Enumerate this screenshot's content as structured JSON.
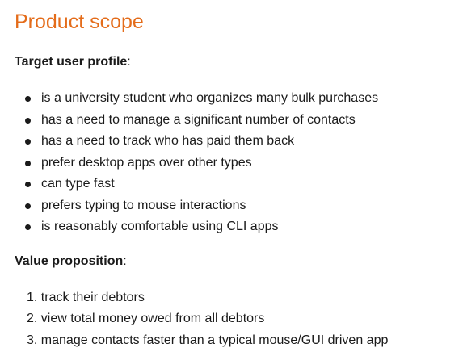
{
  "title": "Product scope",
  "target_user_profile": {
    "label": "Target user profile",
    "suffix": ":",
    "items": [
      "is a university student who organizes many bulk purchases",
      "has a need to manage a significant number of contacts",
      "has a need to track who has paid them back",
      "prefer desktop apps over other types",
      "can type fast",
      "prefers typing to mouse interactions",
      "is reasonably comfortable using CLI apps"
    ]
  },
  "value_proposition": {
    "label": "Value proposition",
    "suffix": ":",
    "items": [
      {
        "number": "1.",
        "text": "track their debtors"
      },
      {
        "number": "2.",
        "text": "view total money owed from all debtors"
      },
      {
        "number": "3.",
        "text": "manage contacts faster than a typical mouse/GUI driven app"
      }
    ]
  },
  "colors": {
    "heading": "#e46c1a",
    "text": "#1a1a1a",
    "background": "#ffffff"
  }
}
